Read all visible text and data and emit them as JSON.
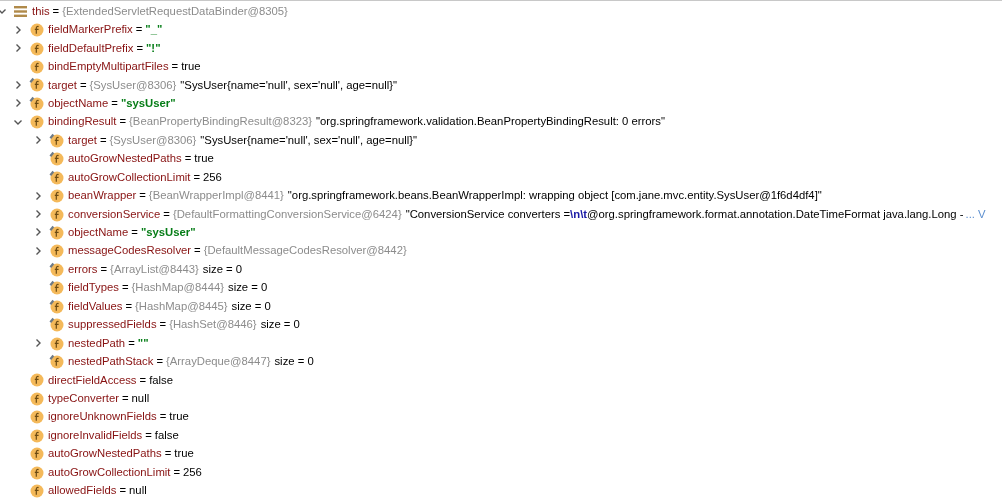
{
  "variables": [
    {
      "name": "this",
      "kind": "object",
      "expanded": true,
      "op": "=",
      "type": "{ExtendedServletRequestDataBinder@8305}",
      "children": [
        {
          "name": "fieldMarkerPrefix",
          "kind": "field",
          "final": false,
          "expanded": false,
          "op": "=",
          "value": "\"_\"",
          "string_literal": true
        },
        {
          "name": "fieldDefaultPrefix",
          "kind": "field",
          "final": false,
          "expanded": false,
          "op": "=",
          "value": "\"!\"",
          "string_literal": true
        },
        {
          "name": "bindEmptyMultipartFiles",
          "kind": "field",
          "final": false,
          "op": "=",
          "value": "true",
          "string_literal": false
        },
        {
          "name": "target",
          "kind": "field",
          "final": true,
          "expanded": false,
          "op": "=",
          "type": "{SysUser@8306}",
          "value": "\"SysUser{name='null', sex='null', age=null}\"",
          "string_literal": false
        },
        {
          "name": "objectName",
          "kind": "field",
          "final": true,
          "expanded": false,
          "op": "=",
          "value": "\"sysUser\"",
          "string_literal": true
        },
        {
          "name": "bindingResult",
          "kind": "field",
          "final": false,
          "expanded": true,
          "op": "=",
          "type": "{BeanPropertyBindingResult@8323}",
          "value": "\"org.springframework.validation.BeanPropertyBindingResult: 0 errors\"",
          "string_literal": false,
          "children": [
            {
              "name": "target",
              "kind": "field",
              "final": true,
              "expanded": false,
              "op": "=",
              "type": "{SysUser@8306}",
              "value": "\"SysUser{name='null', sex='null', age=null}\"",
              "string_literal": false
            },
            {
              "name": "autoGrowNestedPaths",
              "kind": "field",
              "final": true,
              "op": "=",
              "value": "true",
              "string_literal": false
            },
            {
              "name": "autoGrowCollectionLimit",
              "kind": "field",
              "final": true,
              "op": "=",
              "value": "256",
              "string_literal": false
            },
            {
              "name": "beanWrapper",
              "kind": "field",
              "final": false,
              "expanded": false,
              "op": "=",
              "type": "{BeanWrapperImpl@8441}",
              "value": "\"org.springframework.beans.BeanWrapperImpl: wrapping object [com.jane.mvc.entity.SysUser@1f6d4df4]\"",
              "string_literal": false
            },
            {
              "name": "conversionService",
              "kind": "field",
              "final": false,
              "expanded": false,
              "op": "=",
              "type": "{DefaultFormattingConversionService@6424}",
              "value": "\"ConversionService converters =**\\n\\t**@org.springframework.format.annotation.DateTimeFormat java.lang.Long -",
              "string_literal": false,
              "more": "... V"
            },
            {
              "name": "objectName",
              "kind": "field",
              "final": true,
              "expanded": false,
              "op": "=",
              "value": "\"sysUser\"",
              "string_literal": true
            },
            {
              "name": "messageCodesResolver",
              "kind": "field",
              "final": false,
              "expanded": false,
              "op": "=",
              "type": "{DefaultMessageCodesResolver@8442}"
            },
            {
              "name": "errors",
              "kind": "field",
              "final": true,
              "op": "=",
              "type": "{ArrayList@8443}",
              "value": "size = 0",
              "string_literal": false
            },
            {
              "name": "fieldTypes",
              "kind": "field",
              "final": true,
              "op": "=",
              "type": "{HashMap@8444}",
              "value": "size = 0",
              "string_literal": false
            },
            {
              "name": "fieldValues",
              "kind": "field",
              "final": true,
              "op": "=",
              "type": "{HashMap@8445}",
              "value": "size = 0",
              "string_literal": false
            },
            {
              "name": "suppressedFields",
              "kind": "field",
              "final": true,
              "op": "=",
              "type": "{HashSet@8446}",
              "value": "size = 0",
              "string_literal": false
            },
            {
              "name": "nestedPath",
              "kind": "field",
              "final": false,
              "expanded": false,
              "op": "=",
              "value": "\"\"",
              "string_literal": true
            },
            {
              "name": "nestedPathStack",
              "kind": "field",
              "final": true,
              "op": "=",
              "type": "{ArrayDeque@8447}",
              "value": "size = 0",
              "string_literal": false
            }
          ]
        },
        {
          "name": "directFieldAccess",
          "kind": "field",
          "final": false,
          "op": "=",
          "value": "false",
          "string_literal": false
        },
        {
          "name": "typeConverter",
          "kind": "field",
          "final": false,
          "op": "=",
          "value": "null",
          "string_literal": false
        },
        {
          "name": "ignoreUnknownFields",
          "kind": "field",
          "final": false,
          "op": "=",
          "value": "true",
          "string_literal": false
        },
        {
          "name": "ignoreInvalidFields",
          "kind": "field",
          "final": false,
          "op": "=",
          "value": "false",
          "string_literal": false
        },
        {
          "name": "autoGrowNestedPaths",
          "kind": "field",
          "final": false,
          "op": "=",
          "value": "true",
          "string_literal": false
        },
        {
          "name": "autoGrowCollectionLimit",
          "kind": "field",
          "final": false,
          "op": "=",
          "value": "256",
          "string_literal": false
        },
        {
          "name": "allowedFields",
          "kind": "field",
          "final": false,
          "op": "=",
          "value": "null",
          "string_literal": false
        }
      ]
    }
  ]
}
